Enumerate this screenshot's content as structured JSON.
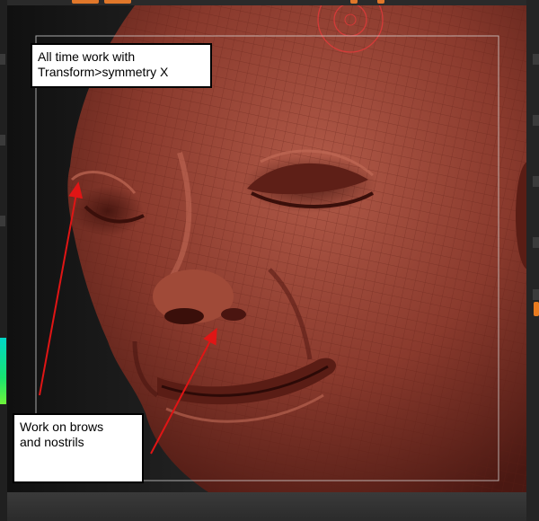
{
  "annotations": {
    "top_note": {
      "line1": "All time work with",
      "line2": "Transform>symmetry X"
    },
    "bottom_note": {
      "line1": "Work on brows",
      "line2": "and nostrils"
    }
  },
  "colors": {
    "skin": "#8d3a2c",
    "arrow": "#e01515",
    "accent": "#e97b1f"
  },
  "viewport": {
    "symmetry_axis": "X"
  }
}
